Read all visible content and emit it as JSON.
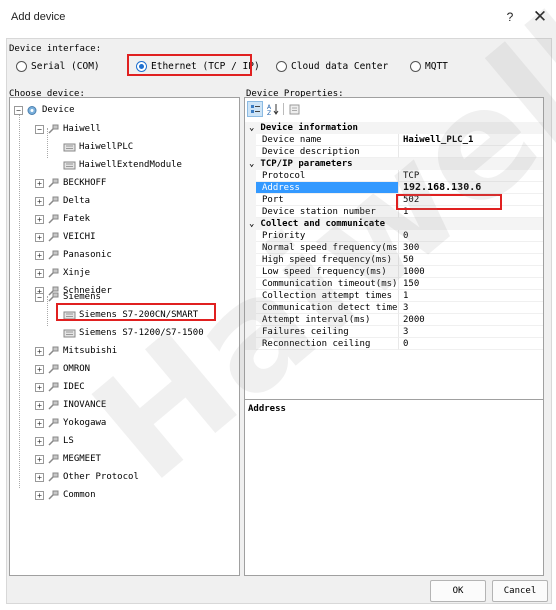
{
  "window": {
    "title": "Add device",
    "help_label": "?",
    "close_label": "✕"
  },
  "interface": {
    "label": "Device interface:",
    "options": [
      {
        "label": "Serial (COM)",
        "checked": false
      },
      {
        "label": "Ethernet (TCP / IP)",
        "checked": true
      },
      {
        "label": "Cloud data Center",
        "checked": false
      },
      {
        "label": "MQTT",
        "checked": false
      }
    ]
  },
  "tree": {
    "label": "Choose device:",
    "nodes": [
      {
        "label": "Device",
        "expander": "−",
        "icon": "device-root-icon"
      },
      {
        "label": "Haiwell",
        "expander": "−",
        "icon": "plug-icon"
      },
      {
        "label": "HaiwellPLC",
        "expander": "",
        "icon": "module-icon"
      },
      {
        "label": "HaiwellExtendModule",
        "expander": "",
        "icon": "module-icon"
      },
      {
        "label": "BECKHOFF",
        "expander": "+",
        "icon": "plug-icon"
      },
      {
        "label": "Delta",
        "expander": "+",
        "icon": "plug-icon"
      },
      {
        "label": "Fatek",
        "expander": "+",
        "icon": "plug-icon"
      },
      {
        "label": "VEICHI",
        "expander": "+",
        "icon": "plug-icon"
      },
      {
        "label": "Panasonic",
        "expander": "+",
        "icon": "plug-icon"
      },
      {
        "label": "Xinje",
        "expander": "+",
        "icon": "plug-icon"
      },
      {
        "label": "Schneider",
        "expander": "+",
        "icon": "plug-icon"
      },
      {
        "label": "Siemens",
        "expander": "−",
        "icon": "plug-icon"
      },
      {
        "label": "Siemens S7-200CN/SMART",
        "expander": "",
        "icon": "module-icon"
      },
      {
        "label": "Siemens S7-1200/S7-1500",
        "expander": "",
        "icon": "module-icon"
      },
      {
        "label": "Mitsubishi",
        "expander": "+",
        "icon": "plug-icon"
      },
      {
        "label": "OMRON",
        "expander": "+",
        "icon": "plug-icon"
      },
      {
        "label": "IDEC",
        "expander": "+",
        "icon": "plug-icon"
      },
      {
        "label": "INOVANCE",
        "expander": "+",
        "icon": "plug-icon"
      },
      {
        "label": "Yokogawa",
        "expander": "+",
        "icon": "plug-icon"
      },
      {
        "label": "LS",
        "expander": "+",
        "icon": "plug-icon"
      },
      {
        "label": "MEGMEET",
        "expander": "+",
        "icon": "plug-icon"
      },
      {
        "label": "Other Protocol",
        "expander": "+",
        "icon": "plug-icon"
      },
      {
        "label": "Common",
        "expander": "+",
        "icon": "plug-icon"
      }
    ]
  },
  "properties": {
    "label": "Device Properties:",
    "toolbar": [
      "categorized-icon",
      "sort-az-icon",
      "property-pages-icon"
    ],
    "rows": [
      {
        "kind": "category",
        "name": "Device information"
      },
      {
        "kind": "prop",
        "name": "Device name",
        "value": "Haiwell_PLC_1",
        "bold": true
      },
      {
        "kind": "prop",
        "name": "Device description",
        "value": ""
      },
      {
        "kind": "category",
        "name": "TCP/IP parameters"
      },
      {
        "kind": "prop",
        "name": "Protocol",
        "value": "TCP"
      },
      {
        "kind": "prop",
        "name": "Address",
        "value": "192.168.130.6",
        "selected": true
      },
      {
        "kind": "prop",
        "name": "Port",
        "value": "502"
      },
      {
        "kind": "prop",
        "name": "Device station number",
        "value": "1"
      },
      {
        "kind": "category",
        "name": "Collect and communicate"
      },
      {
        "kind": "prop",
        "name": "Priority",
        "value": "0"
      },
      {
        "kind": "prop",
        "name": "Normal speed frequency(ms)",
        "value": "300"
      },
      {
        "kind": "prop",
        "name": "High speed frequency(ms)",
        "value": "50"
      },
      {
        "kind": "prop",
        "name": "Low speed frequency(ms)",
        "value": "1000"
      },
      {
        "kind": "prop",
        "name": "Communication timeout(ms)",
        "value": "150"
      },
      {
        "kind": "prop",
        "name": "Collection attempt times",
        "value": "1"
      },
      {
        "kind": "prop",
        "name": "Communication detect times",
        "value": "3"
      },
      {
        "kind": "prop",
        "name": "Attempt interval(ms)",
        "value": "2000"
      },
      {
        "kind": "prop",
        "name": "Failures ceiling",
        "value": "3"
      },
      {
        "kind": "prop",
        "name": "Reconnection ceiling",
        "value": "0"
      }
    ],
    "description_title": "Address"
  },
  "footer": {
    "ok_label": "OK",
    "cancel_label": "Cancel"
  },
  "watermark": "Haiwell",
  "colors": {
    "highlight": "#e02020",
    "selection": "#3399ff",
    "radio_accent": "#1e6fcf"
  }
}
